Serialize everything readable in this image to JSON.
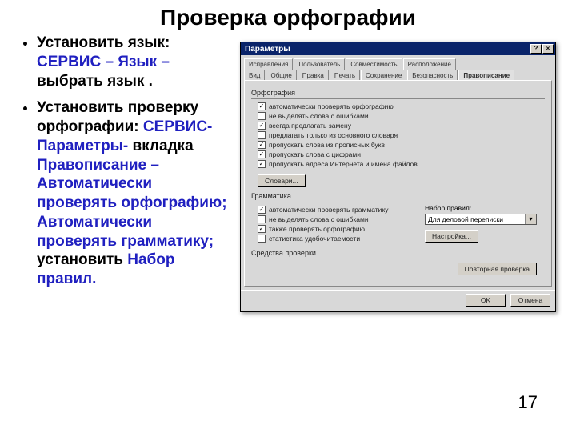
{
  "title": "Проверка орфографии",
  "bullets": {
    "b1": {
      "lead": "Установить язык: ",
      "blue": "СЕРВИС – Язык –",
      "tail": "выбрать язык ."
    },
    "b2": {
      "lead": "Установить проверку орфографии: ",
      "blue1": "СЕРВИС-Параметры-",
      "black1": " вкладка ",
      "blue2": "Правописание – Автоматически проверять орфографию; Автоматически проверять грамматику;",
      "black2": " установить ",
      "blue3": "Набор правил."
    }
  },
  "dialog": {
    "caption": "Параметры",
    "tabs_row1": [
      "Исправления",
      "Пользователь",
      "Совместимость",
      "Расположение"
    ],
    "tabs_row2": [
      "Вид",
      "Общие",
      "Правка",
      "Печать",
      "Сохранение",
      "Безопасность",
      "Правописание"
    ],
    "active_tab": 6,
    "groups": {
      "g1": {
        "head": "Орфография",
        "items": [
          {
            "checked": true,
            "label": "автоматически проверять орфографию"
          },
          {
            "checked": false,
            "label": "не выделять слова с ошибками"
          },
          {
            "checked": true,
            "label": "всегда предлагать замену"
          },
          {
            "checked": false,
            "label": "предлагать только из основного словаря"
          },
          {
            "checked": true,
            "label": "пропускать слова из прописных букв"
          },
          {
            "checked": true,
            "label": "пропускать слова с цифрами"
          },
          {
            "checked": true,
            "label": "пропускать адреса Интернета и имена файлов"
          }
        ],
        "btn": "Словари..."
      },
      "g2": {
        "head": "Грамматика",
        "items": [
          {
            "checked": true,
            "label": "автоматически проверять грамматику"
          },
          {
            "checked": false,
            "label": "не выделять слова с ошибками"
          },
          {
            "checked": true,
            "label": "также проверять орфографию"
          },
          {
            "checked": false,
            "label": "статистика удобочитаемости"
          }
        ],
        "combo_label": "Набор правил:",
        "combo_value": "Для деловой переписки",
        "btn": "Настройка..."
      },
      "g3": {
        "head": "Средства проверки",
        "btn": "Повторная проверка"
      }
    },
    "ok": "OK",
    "cancel": "Отмена"
  },
  "page_number": "17"
}
